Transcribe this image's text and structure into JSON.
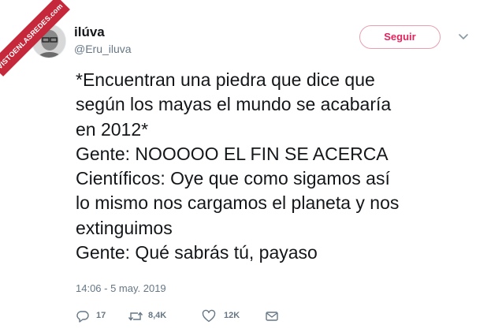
{
  "watermark": "VISTOENLASREDES",
  "watermark_suffix": ".com",
  "user": {
    "display_name": "ilúva",
    "handle": "@Eru_iluva"
  },
  "follow_label": "Seguir",
  "tweet_lines": [
    "*Encuentran una piedra que dice que",
    "según los mayas el mundo se acabaría",
    "en 2012*",
    "Gente: NOOOOO EL FIN SE ACERCA",
    "Científicos: Oye que como sigamos así",
    "lo mismo nos cargamos el planeta y nos",
    "extinguimos",
    "Gente: Qué sabrás tú, payaso"
  ],
  "timestamp": "14:06 - 5 may. 2019",
  "actions": {
    "replies": "17",
    "retweets": "8,4K",
    "likes": "12K"
  },
  "colors": {
    "follow_accent": "#e0245e",
    "muted_text": "#657786",
    "watermark_bg": "#c4283a"
  },
  "icons": [
    "avatar-image",
    "chevron-down-icon",
    "reply-icon",
    "retweet-icon",
    "like-icon",
    "message-icon"
  ]
}
